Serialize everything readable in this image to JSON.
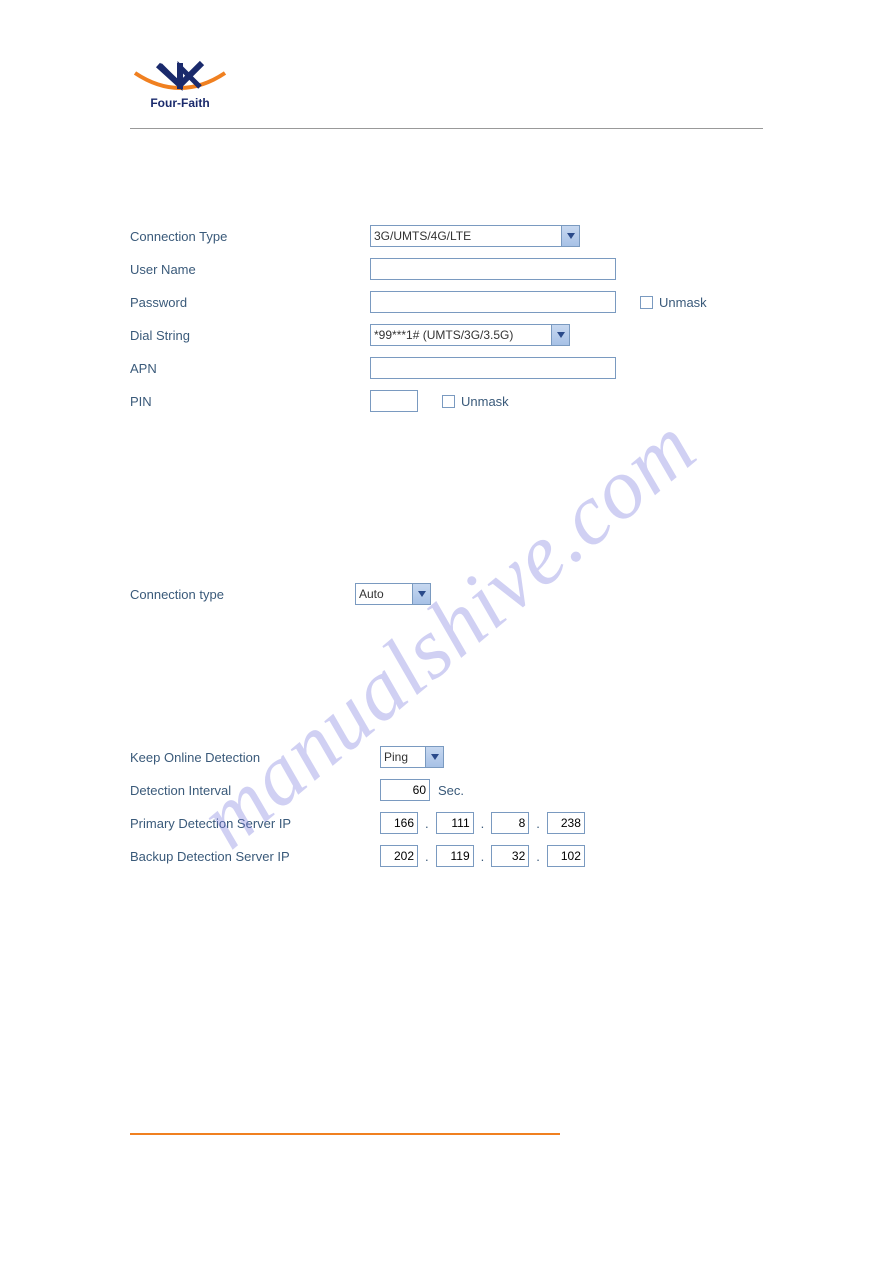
{
  "brand": "Four-Faith",
  "watermark": "manualshive.com",
  "section1": {
    "connection_type": {
      "label": "Connection Type",
      "value": "3G/UMTS/4G/LTE"
    },
    "user_name": {
      "label": "User Name",
      "value": ""
    },
    "password": {
      "label": "Password",
      "value": "",
      "unmask_label": "Unmask"
    },
    "dial_string": {
      "label": "Dial String",
      "value": "*99***1# (UMTS/3G/3.5G)"
    },
    "apn": {
      "label": "APN",
      "value": ""
    },
    "pin": {
      "label": "PIN",
      "value": "",
      "unmask_label": "Unmask"
    }
  },
  "section2": {
    "connection_type": {
      "label": "Connection type",
      "value": "Auto"
    }
  },
  "section3": {
    "keep_online": {
      "label": "Keep Online Detection",
      "value": "Ping"
    },
    "interval": {
      "label": "Detection Interval",
      "value": "60",
      "unit": "Sec."
    },
    "primary_ip": {
      "label": "Primary Detection Server IP",
      "octets": [
        "166",
        "111",
        "8",
        "238"
      ]
    },
    "backup_ip": {
      "label": "Backup Detection Server IP",
      "octets": [
        "202",
        "119",
        "32",
        "102"
      ]
    }
  }
}
